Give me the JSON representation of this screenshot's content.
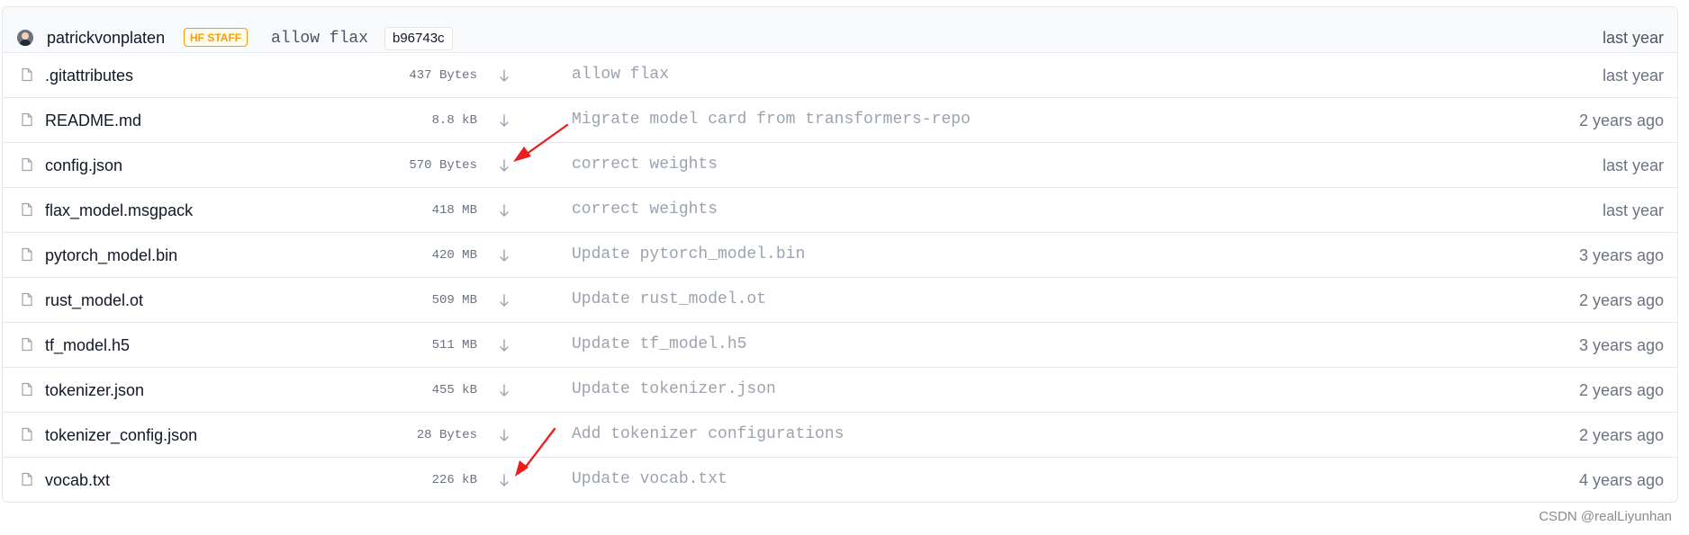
{
  "commit": {
    "author": "patrickvonplaten",
    "badge": "HF STAFF",
    "message": "allow flax",
    "hash": "b96743c",
    "time": "last year"
  },
  "files": [
    {
      "name": ".gitattributes",
      "size": "437 Bytes",
      "message": "allow flax",
      "time": "last year"
    },
    {
      "name": "README.md",
      "size": "8.8 kB",
      "message": "Migrate model card from transformers-repo",
      "time": "2 years ago"
    },
    {
      "name": "config.json",
      "size": "570 Bytes",
      "message": "correct weights",
      "time": "last year"
    },
    {
      "name": "flax_model.msgpack",
      "size": "418 MB",
      "message": "correct weights",
      "time": "last year"
    },
    {
      "name": "pytorch_model.bin",
      "size": "420 MB",
      "message": "Update pytorch_model.bin",
      "time": "3 years ago"
    },
    {
      "name": "rust_model.ot",
      "size": "509 MB",
      "message": "Update rust_model.ot",
      "time": "2 years ago"
    },
    {
      "name": "tf_model.h5",
      "size": "511 MB",
      "message": "Update tf_model.h5",
      "time": "3 years ago"
    },
    {
      "name": "tokenizer.json",
      "size": "455 kB",
      "message": "Update tokenizer.json",
      "time": "2 years ago"
    },
    {
      "name": "tokenizer_config.json",
      "size": "28 Bytes",
      "message": "Add tokenizer configurations",
      "time": "2 years ago"
    },
    {
      "name": "vocab.txt",
      "size": "226 kB",
      "message": "Update vocab.txt",
      "time": "4 years ago"
    }
  ],
  "icons": {
    "avatar": "user-avatar",
    "file": "file-icon",
    "download": "download-arrow-icon",
    "annotation": "red-arrow-icon"
  },
  "colors": {
    "badge": "#f59e0b",
    "annotation": "#ef1c1c"
  },
  "watermark": "CSDN @realLiyunhan"
}
